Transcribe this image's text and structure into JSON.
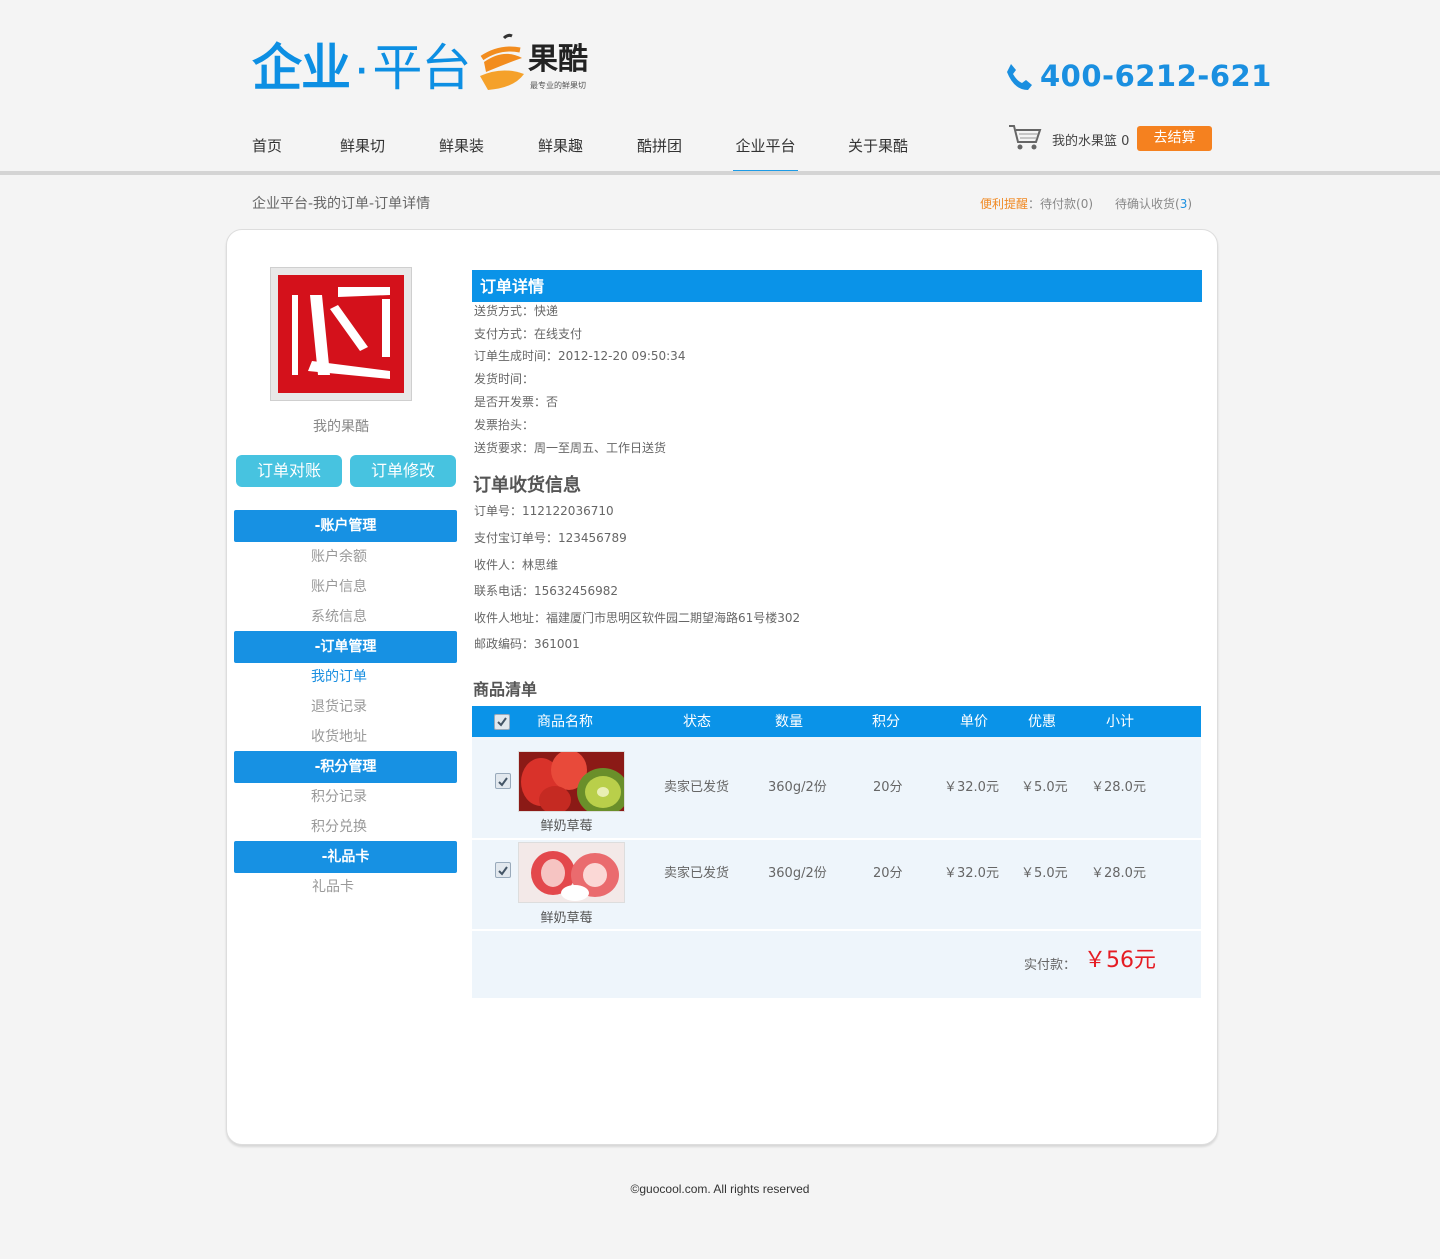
{
  "header": {
    "brand_left": "企业",
    "brand_dot": "·",
    "brand_right": "平台",
    "logo_text": "果酷",
    "logo_slogan": "最专业的鲜果切",
    "phone": "400-6212-621"
  },
  "nav": {
    "items": [
      "首页",
      "鲜果切",
      "鲜果装",
      "鲜果趣",
      "酷拼团",
      "企业平台",
      "关于果酷"
    ],
    "active": "企业平台"
  },
  "cart": {
    "label": "我的水果篮 0",
    "checkout": "去结算"
  },
  "breadcrumb": "企业平台-我的订单-订单详情",
  "reminder": {
    "label": "便利提醒",
    "pending_pay_prefix": "：待付款(0)",
    "pending_confirm_prefix": "待确认收货(",
    "pending_confirm_count": "3",
    "pending_confirm_suffix": ")"
  },
  "sidebar": {
    "my_label": "我的果酷",
    "btn_reconcile": "订单对账",
    "btn_modify": "订单修改",
    "groups": [
      {
        "title": "-账户管理",
        "items": [
          "账户余额",
          "账户信息",
          "系统信息"
        ]
      },
      {
        "title": "-订单管理",
        "items": [
          "我的订单",
          "退货记录",
          "收货地址"
        ]
      },
      {
        "title": "-积分管理",
        "items": [
          "积分记录",
          "积分兑换"
        ]
      },
      {
        "title": "-礼品卡",
        "items": [
          "礼品卡"
        ]
      }
    ],
    "active_item": "我的订单"
  },
  "order_detail": {
    "title": "订单详情",
    "lines": [
      "送货方式：快递",
      "支付方式：在线支付",
      "订单生成时间：2012-12-20 09:50:34",
      "发货时间：",
      "是否开发票：否",
      "发票抬头：",
      "送货要求：周一至周五、工作日送货"
    ]
  },
  "receipt": {
    "title": "订单收货信息",
    "lines": [
      "订单号：112122036710",
      "支付宝订单号：123456789",
      "收件人：林思维",
      "联系电话：15632456982",
      "收件人地址：福建厦门市思明区软件园二期望海路61号楼302",
      "邮政编码：361001"
    ]
  },
  "products": {
    "title": "商品清单",
    "columns": [
      "商品名称",
      "状态",
      "数量",
      "积分",
      "单价",
      "优惠",
      "小计"
    ],
    "rows": [
      {
        "name": "鲜奶草莓",
        "status": "卖家已发货",
        "qty": "360g/2份",
        "points": "20分",
        "price": "￥32.0元",
        "discount": "￥5.0元",
        "subtotal": "￥28.0元"
      },
      {
        "name": "鲜奶草莓",
        "status": "卖家已发货",
        "qty": "360g/2份",
        "points": "20分",
        "price": "￥32.0元",
        "discount": "￥5.0元",
        "subtotal": "￥28.0元"
      }
    ],
    "total_label": "实付款：",
    "total_value": "￥56元"
  },
  "footer": "©guocool.com. All rights reserved",
  "colors": {
    "accent": "#0a93e8",
    "orange": "#f5811f",
    "price_red": "#e51c23",
    "teal": "#47c3e0"
  }
}
